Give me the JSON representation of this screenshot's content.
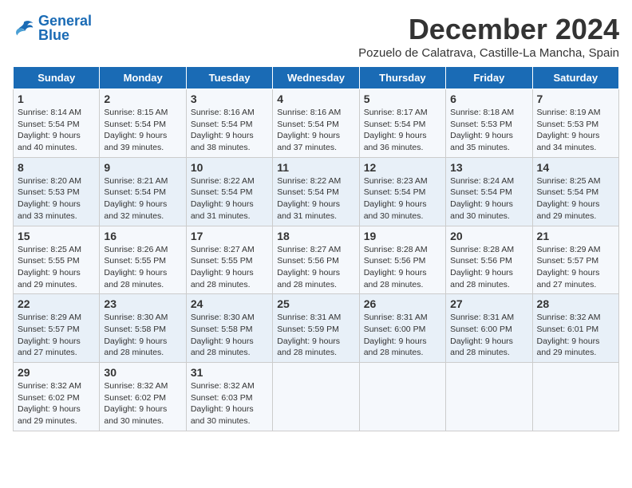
{
  "logo": {
    "line1": "General",
    "line2": "Blue"
  },
  "title": "December 2024",
  "subtitle": "Pozuelo de Calatrava, Castille-La Mancha, Spain",
  "days_header": [
    "Sunday",
    "Monday",
    "Tuesday",
    "Wednesday",
    "Thursday",
    "Friday",
    "Saturday"
  ],
  "weeks": [
    [
      {
        "day": "1",
        "sunrise": "8:14 AM",
        "sunset": "5:54 PM",
        "daylight": "9 hours and 40 minutes."
      },
      {
        "day": "2",
        "sunrise": "8:15 AM",
        "sunset": "5:54 PM",
        "daylight": "9 hours and 39 minutes."
      },
      {
        "day": "3",
        "sunrise": "8:16 AM",
        "sunset": "5:54 PM",
        "daylight": "9 hours and 38 minutes."
      },
      {
        "day": "4",
        "sunrise": "8:16 AM",
        "sunset": "5:54 PM",
        "daylight": "9 hours and 37 minutes."
      },
      {
        "day": "5",
        "sunrise": "8:17 AM",
        "sunset": "5:54 PM",
        "daylight": "9 hours and 36 minutes."
      },
      {
        "day": "6",
        "sunrise": "8:18 AM",
        "sunset": "5:53 PM",
        "daylight": "9 hours and 35 minutes."
      },
      {
        "day": "7",
        "sunrise": "8:19 AM",
        "sunset": "5:53 PM",
        "daylight": "9 hours and 34 minutes."
      }
    ],
    [
      {
        "day": "8",
        "sunrise": "8:20 AM",
        "sunset": "5:53 PM",
        "daylight": "9 hours and 33 minutes."
      },
      {
        "day": "9",
        "sunrise": "8:21 AM",
        "sunset": "5:54 PM",
        "daylight": "9 hours and 32 minutes."
      },
      {
        "day": "10",
        "sunrise": "8:22 AM",
        "sunset": "5:54 PM",
        "daylight": "9 hours and 31 minutes."
      },
      {
        "day": "11",
        "sunrise": "8:22 AM",
        "sunset": "5:54 PM",
        "daylight": "9 hours and 31 minutes."
      },
      {
        "day": "12",
        "sunrise": "8:23 AM",
        "sunset": "5:54 PM",
        "daylight": "9 hours and 30 minutes."
      },
      {
        "day": "13",
        "sunrise": "8:24 AM",
        "sunset": "5:54 PM",
        "daylight": "9 hours and 30 minutes."
      },
      {
        "day": "14",
        "sunrise": "8:25 AM",
        "sunset": "5:54 PM",
        "daylight": "9 hours and 29 minutes."
      }
    ],
    [
      {
        "day": "15",
        "sunrise": "8:25 AM",
        "sunset": "5:55 PM",
        "daylight": "9 hours and 29 minutes."
      },
      {
        "day": "16",
        "sunrise": "8:26 AM",
        "sunset": "5:55 PM",
        "daylight": "9 hours and 28 minutes."
      },
      {
        "day": "17",
        "sunrise": "8:27 AM",
        "sunset": "5:55 PM",
        "daylight": "9 hours and 28 minutes."
      },
      {
        "day": "18",
        "sunrise": "8:27 AM",
        "sunset": "5:56 PM",
        "daylight": "9 hours and 28 minutes."
      },
      {
        "day": "19",
        "sunrise": "8:28 AM",
        "sunset": "5:56 PM",
        "daylight": "9 hours and 28 minutes."
      },
      {
        "day": "20",
        "sunrise": "8:28 AM",
        "sunset": "5:56 PM",
        "daylight": "9 hours and 28 minutes."
      },
      {
        "day": "21",
        "sunrise": "8:29 AM",
        "sunset": "5:57 PM",
        "daylight": "9 hours and 27 minutes."
      }
    ],
    [
      {
        "day": "22",
        "sunrise": "8:29 AM",
        "sunset": "5:57 PM",
        "daylight": "9 hours and 27 minutes."
      },
      {
        "day": "23",
        "sunrise": "8:30 AM",
        "sunset": "5:58 PM",
        "daylight": "9 hours and 28 minutes."
      },
      {
        "day": "24",
        "sunrise": "8:30 AM",
        "sunset": "5:58 PM",
        "daylight": "9 hours and 28 minutes."
      },
      {
        "day": "25",
        "sunrise": "8:31 AM",
        "sunset": "5:59 PM",
        "daylight": "9 hours and 28 minutes."
      },
      {
        "day": "26",
        "sunrise": "8:31 AM",
        "sunset": "6:00 PM",
        "daylight": "9 hours and 28 minutes."
      },
      {
        "day": "27",
        "sunrise": "8:31 AM",
        "sunset": "6:00 PM",
        "daylight": "9 hours and 28 minutes."
      },
      {
        "day": "28",
        "sunrise": "8:32 AM",
        "sunset": "6:01 PM",
        "daylight": "9 hours and 29 minutes."
      }
    ],
    [
      {
        "day": "29",
        "sunrise": "8:32 AM",
        "sunset": "6:02 PM",
        "daylight": "9 hours and 29 minutes."
      },
      {
        "day": "30",
        "sunrise": "8:32 AM",
        "sunset": "6:02 PM",
        "daylight": "9 hours and 30 minutes."
      },
      {
        "day": "31",
        "sunrise": "8:32 AM",
        "sunset": "6:03 PM",
        "daylight": "9 hours and 30 minutes."
      },
      null,
      null,
      null,
      null
    ]
  ]
}
